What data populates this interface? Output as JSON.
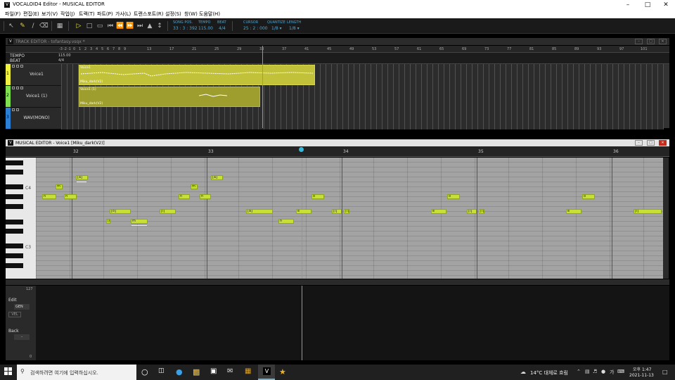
{
  "window": {
    "title": "VOCALOID4 Editor - MUSICAL EDITOR",
    "app_icon": "V"
  },
  "menu": [
    "파일(F)",
    "편집(E)",
    "보기(V)",
    "작업(J)",
    "트랙(T)",
    "파트(P)",
    "가사(L)",
    "트랜스포트(R)",
    "설정(S)",
    "창(W)",
    "도움말(H)"
  ],
  "toolbar": {
    "song_pos_label": "SONG POS.",
    "song_pos": "33 : 3 : 392",
    "tempo_label": "TEMPO",
    "tempo": "115.00",
    "beat_label": "BEAT",
    "beat": "4/4",
    "cursor_label": "CURSOR",
    "cursor": "25 : 2 : 000",
    "quantize_label": "QUANTIZE",
    "quantize": "1/8",
    "length_label": "LENGTH",
    "length": "1/8",
    "quantize_arrow": "▾",
    "length_arrow": "▾",
    "tools": [
      "pointer-tool",
      "pencil-tool",
      "line-tool",
      "eraser-tool",
      "realtime-input"
    ],
    "transport": [
      "play",
      "stop",
      "loop",
      "to-start",
      "rewind",
      "fast-forward",
      "to-end",
      "metronome",
      "playback-mode"
    ]
  },
  "track_editor": {
    "title": "TRACK EDITOR - tofantasy.vsqx *",
    "tempo_label": "TEMPO",
    "tempo_value": "115.00",
    "beat_label": "BEAT",
    "beat_value": "4/4",
    "ruler": [
      "-3",
      "-2",
      "-1",
      "0",
      "1",
      "2",
      "3",
      "4",
      "5",
      "6",
      "7",
      "8",
      "9",
      "13",
      "17",
      "21",
      "25",
      "29",
      "33",
      "37",
      "41",
      "45",
      "49",
      "53",
      "57",
      "61",
      "65",
      "69",
      "73",
      "77",
      "81",
      "85",
      "89",
      "93",
      "97",
      "101"
    ],
    "tracks": [
      {
        "num": "1",
        "name": "Voice1",
        "color": "#f0f040",
        "part_name": "Voice1",
        "part_singer": "Miku_dark(V2)"
      },
      {
        "num": "2",
        "name": "Voice1 (1)",
        "color": "#80e050",
        "part_name": "Voice1 (1)",
        "part_singer": "Miku_dark(V2)"
      },
      {
        "num": "3",
        "name": "WAV(MONO)",
        "color": "#2b7fd4"
      }
    ]
  },
  "musical_editor": {
    "title": "MUSICAL EDITOR - Voice1 [Miku_dark(V2)]",
    "bars": [
      "32",
      "33",
      "34",
      "35",
      "36"
    ],
    "octave_labels": [
      "C4",
      "C3"
    ],
    "notes": [
      {
        "lyric": "[a]"
      },
      {
        "lyric": "m"
      },
      {
        "lyric": "n"
      },
      {
        "lyric": "n"
      },
      {
        "lyric": "[o]"
      },
      {
        "lyric": "[i]"
      },
      {
        "lyric": "m"
      },
      {
        "lyric": "[i]"
      },
      {
        "lyric": "m"
      },
      {
        "lyric": "[a]"
      },
      {
        "lyric": "n"
      },
      {
        "lyric": "n"
      },
      {
        "lyric": "[a]"
      },
      {
        "lyric": "n"
      },
      {
        "lyric": "e"
      },
      {
        "lyric": "o"
      },
      {
        "lyric": "[i]"
      },
      {
        "lyric": "[i]"
      },
      {
        "lyric": "e"
      },
      {
        "lyric": "o"
      },
      {
        "lyric": "[i]"
      },
      {
        "lyric": "[i]"
      },
      {
        "lyric": "e"
      },
      {
        "lyric": "o"
      },
      {
        "lyric": "[i]"
      }
    ]
  },
  "control": {
    "max": "127",
    "min": "0",
    "edit_label": "Edit",
    "edit_value": "GEN",
    "vel_label": "VEL",
    "back_label": "Back",
    "back_value": "-"
  },
  "taskbar": {
    "search_placeholder": "검색하려면 여기에 입력하십시오.",
    "weather": "14°C  대체로 흐림",
    "time": "오후 1:47",
    "date": "2021-11-13",
    "ime": "가"
  }
}
